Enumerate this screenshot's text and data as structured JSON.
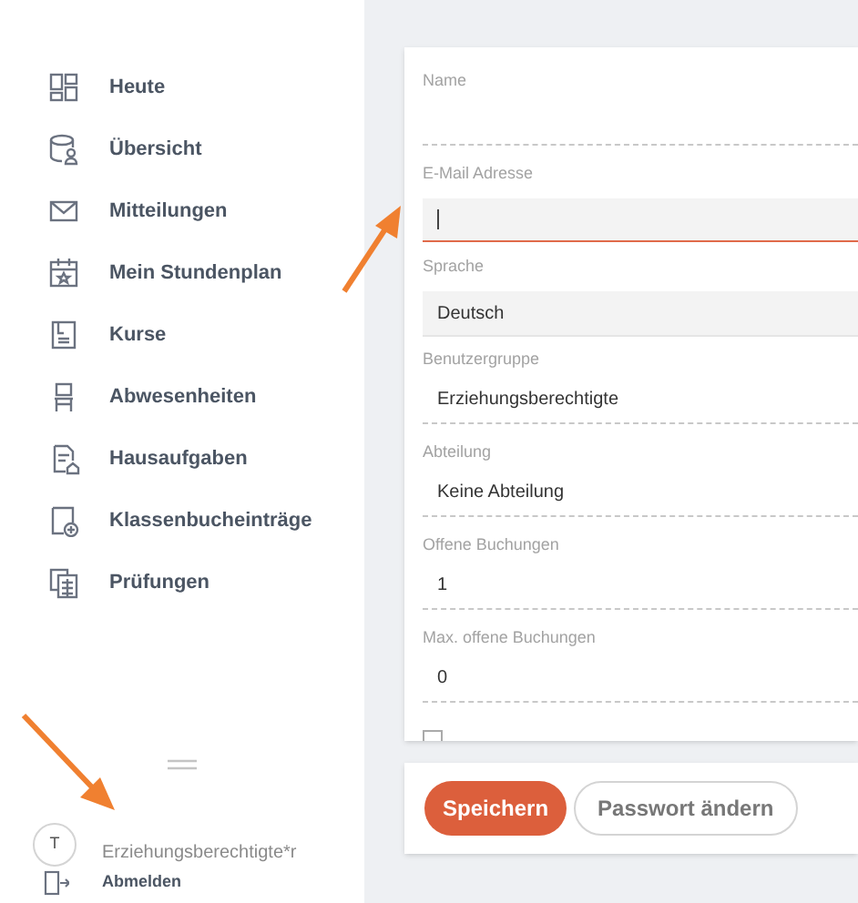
{
  "sidebar": {
    "items": [
      {
        "label": "Heute"
      },
      {
        "label": "Übersicht"
      },
      {
        "label": "Mitteilungen"
      },
      {
        "label": "Mein Stundenplan"
      },
      {
        "label": "Kurse"
      },
      {
        "label": "Abwesenheiten"
      },
      {
        "label": "Hausaufgaben"
      },
      {
        "label": "Klassenbucheinträge"
      },
      {
        "label": "Prüfungen"
      }
    ],
    "user": {
      "avatar": "T",
      "role": "Erziehungsberechtigte*r",
      "logout": "Abmelden"
    }
  },
  "form": {
    "fields": [
      {
        "label": "Name",
        "kind": "line",
        "focused": false
      },
      {
        "label": "E-Mail Adresse",
        "kind": "input",
        "focused": true
      },
      {
        "label": "Sprache",
        "kind": "select",
        "value": "Deutsch",
        "focused": false
      },
      {
        "label": "Benutzergruppe",
        "kind": "line",
        "value": "Erziehungsberechtigte",
        "focused": false
      },
      {
        "label": "Abteilung",
        "kind": "line",
        "value": "Keine Abteilung",
        "focused": false
      },
      {
        "label": "Offene Buchungen",
        "kind": "line",
        "value": "1",
        "focused": false
      },
      {
        "label": "Max. offene Buchungen",
        "kind": "line",
        "value": "0",
        "focused": false
      }
    ],
    "checkbox": {
      "checked": false
    }
  },
  "buttons": [
    {
      "label": "Speichern",
      "kind": "primary"
    },
    {
      "label": "Passwort ändern",
      "kind": "secondary"
    }
  ]
}
